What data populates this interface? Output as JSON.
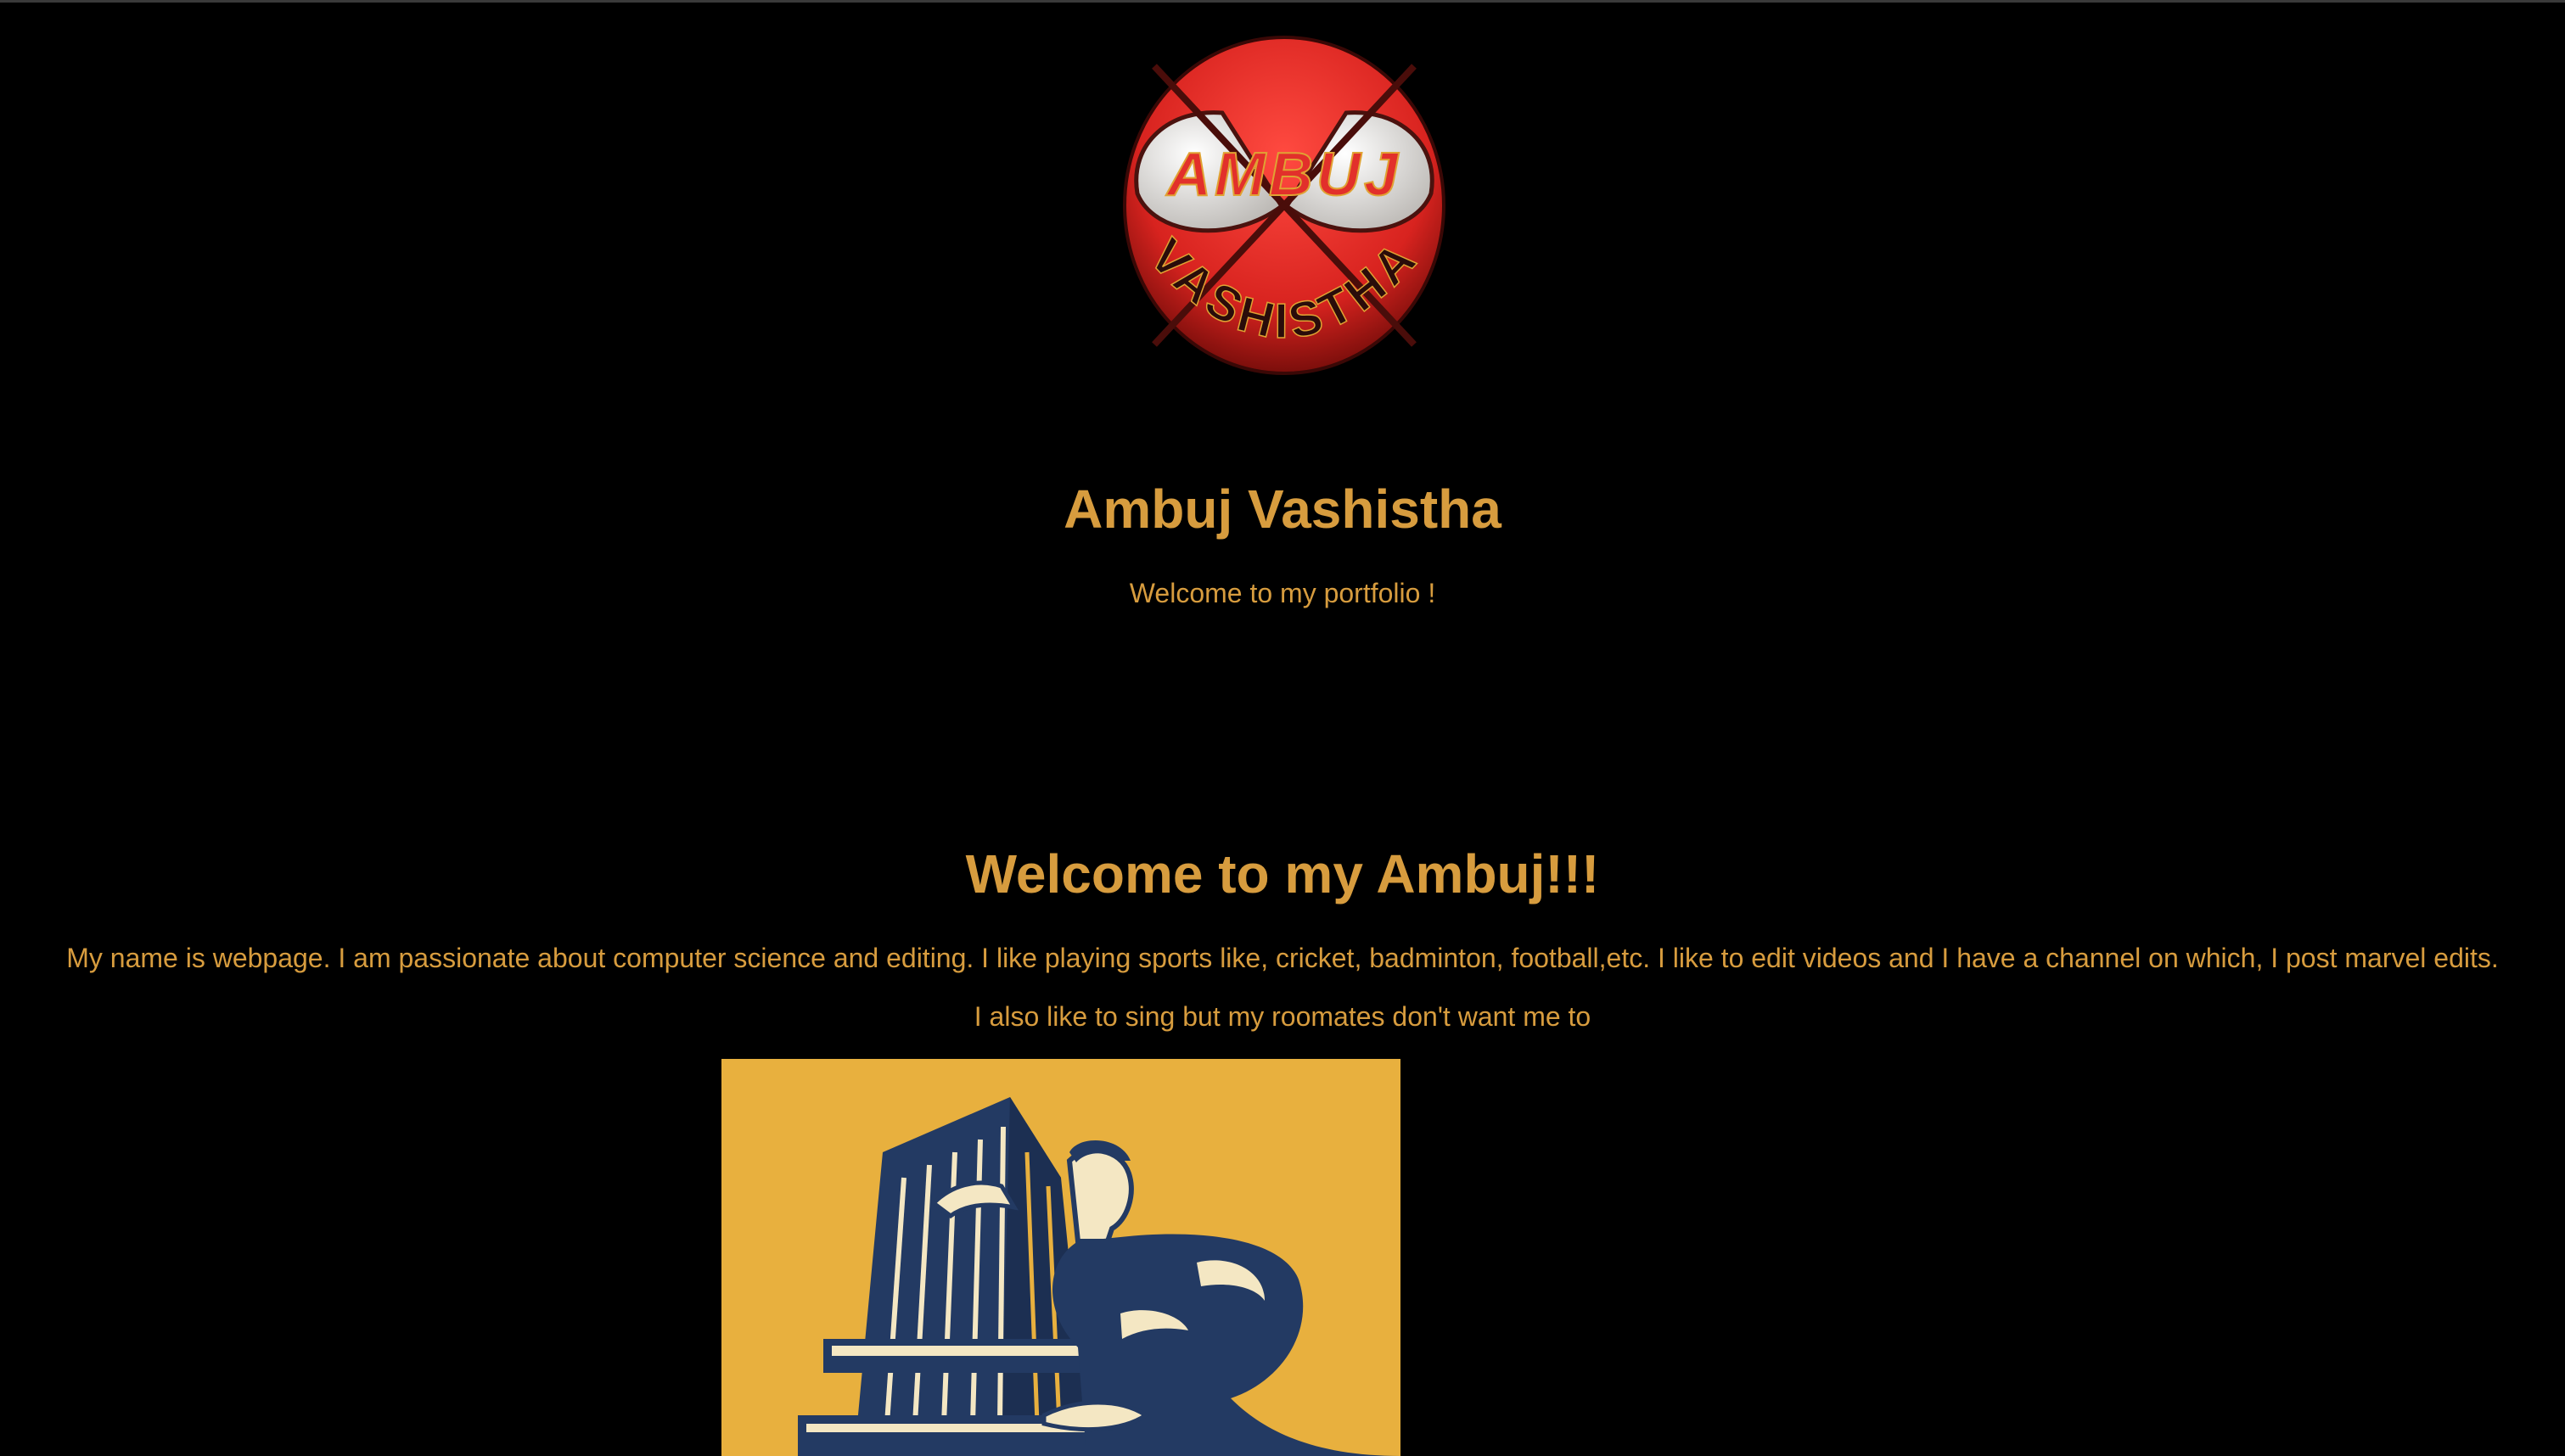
{
  "logo": {
    "name": "logo",
    "lettering_top": "AMBUJ",
    "lettering_bottom": "VASHISTHA",
    "colors": {
      "red": "#e2302b",
      "white": "#ecebe9",
      "gold": "#e0a233",
      "dark": "#2a0c0a"
    }
  },
  "header": {
    "title": "Ambuj Vashistha",
    "subtitle": "Welcome to my portfolio !"
  },
  "about": {
    "heading": "Welcome to my Ambuj!!!",
    "paragraph_1": "My name is webpage. I am passionate about computer science and editing. I like playing sports like, cricket, badminton, football,etc. I like to edit videos and I have a channel on which, I post marvel edits.",
    "paragraph_2": "I also like to sing but my roomates don't want me to"
  },
  "poster": {
    "name": "illustration",
    "colors": {
      "background": "#e8b03e",
      "navy": "#233a63",
      "cream": "#f4e7c3"
    }
  },
  "theme": {
    "background": "#000000",
    "text": "#d79c3e"
  }
}
